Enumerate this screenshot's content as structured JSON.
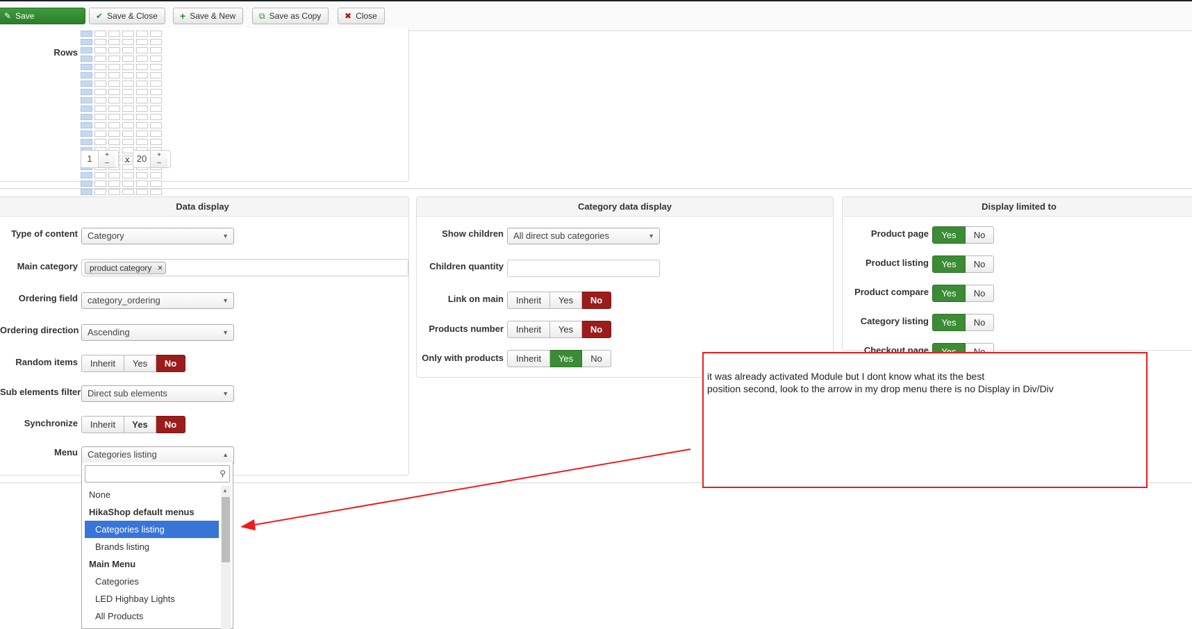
{
  "toolbar": {
    "save": "Save",
    "save_close": "Save & Close",
    "save_new": "Save & New",
    "save_copy": "Save as Copy",
    "close": "Close"
  },
  "rows_section": {
    "label": "Rows",
    "cols_value": "1",
    "rows_value": "20",
    "times": "x",
    "plus": "+",
    "minus": "–"
  },
  "data_display": {
    "title": "Data display",
    "type_of_content": {
      "label": "Type of content",
      "value": "Category"
    },
    "main_category": {
      "label": "Main category",
      "tag": "product category"
    },
    "ordering_field": {
      "label": "Ordering field",
      "value": "category_ordering"
    },
    "ordering_direction": {
      "label": "Ordering direction",
      "value": "Ascending"
    },
    "random_items": {
      "label": "Random items",
      "options": [
        "Inherit",
        "Yes",
        "No"
      ]
    },
    "sub_elements_filter": {
      "label": "Sub elements filter",
      "value": "Direct sub elements"
    },
    "synchronize": {
      "label": "Synchronize",
      "options": [
        "Inherit",
        "Yes",
        "No"
      ]
    },
    "menu": {
      "label": "Menu",
      "value": "Categories listing"
    }
  },
  "category_data_display": {
    "title": "Category data display",
    "show_children": {
      "label": "Show children",
      "value": "All direct sub categories"
    },
    "children_quantity": {
      "label": "Children quantity"
    },
    "link_on_main": {
      "label": "Link on main",
      "options": [
        "Inherit",
        "Yes",
        "No"
      ]
    },
    "products_number": {
      "label": "Products number",
      "options": [
        "Inherit",
        "Yes",
        "No"
      ]
    },
    "only_with_products": {
      "label": "Only with products",
      "options": [
        "Inherit",
        "Yes",
        "No"
      ]
    }
  },
  "display_limited_to": {
    "title": "Display limited to",
    "product_page": {
      "label": "Product page",
      "options": [
        "Yes",
        "No"
      ]
    },
    "product_listing": {
      "label": "Product listing",
      "options": [
        "Yes",
        "No"
      ]
    },
    "product_compare": {
      "label": "Product compare",
      "options": [
        "Yes",
        "No"
      ]
    },
    "category_listing": {
      "label": "Category listing",
      "options": [
        "Yes",
        "No"
      ]
    },
    "checkout_page": {
      "label": "Checkout page",
      "options": [
        "Yes",
        "No"
      ]
    }
  },
  "menu_dropdown": {
    "items": [
      "None",
      "HikaShop default menus",
      "Categories listing",
      "Brands listing",
      "Main Menu",
      "Categories",
      "LED Highbay Lights",
      "All Products"
    ]
  },
  "annotation": {
    "line1": "it was already activated Module but I dont know what its the best",
    "line2": "position second, look to the arrow in my drop menu there is no Display in Div/Div",
    "color": "#ee1c1c"
  },
  "colors": {
    "save_green": "#2f8a2f",
    "yes_green": "#3b8c35",
    "no_red": "#9c1c1c",
    "highlight_blue": "#3875d7"
  }
}
